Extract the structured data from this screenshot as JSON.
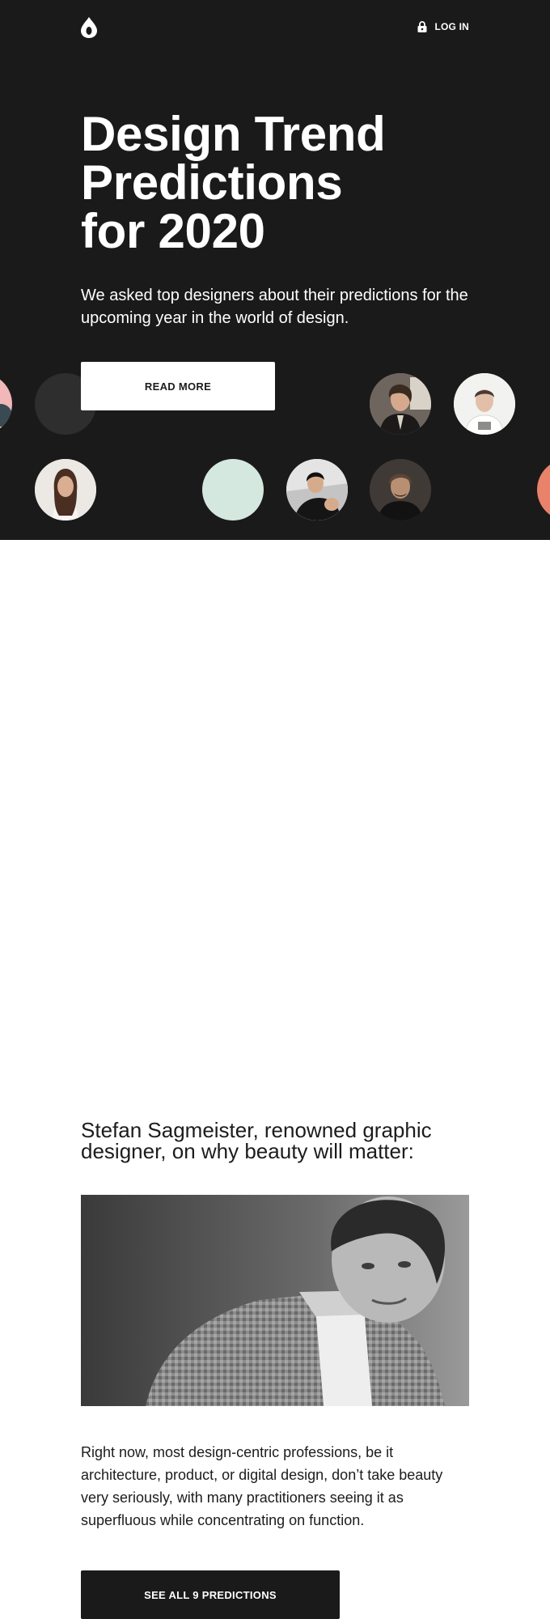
{
  "header": {
    "logo_icon": "drop-logo-icon",
    "login_icon": "lock-icon",
    "login_label": "LOG IN"
  },
  "hero": {
    "title_lines": [
      "Design Trend",
      "Predictions",
      "for 2020"
    ],
    "subtitle": "We asked top designers about their predictions for the upcoming year in the world of design.",
    "cta_label": "READ MORE",
    "background": "#1b1a1a",
    "avatar_colors": {
      "mint": "#d5e8e0",
      "coral": "#e8826a",
      "pink": "#f0b8b8",
      "charcoal": "#2f2e2e"
    }
  },
  "article": {
    "heading": "Stefan Sagmeister, renowned graphic designer, on why beauty will matter:",
    "body": "Right now, most design-centric professions, be it architecture, product, or digital design, don’t take beauty very seriously, with many practitioners seeing it as superfluous while concentrating on function.",
    "cta_label": "SEE ALL 9 PREDICTIONS"
  }
}
